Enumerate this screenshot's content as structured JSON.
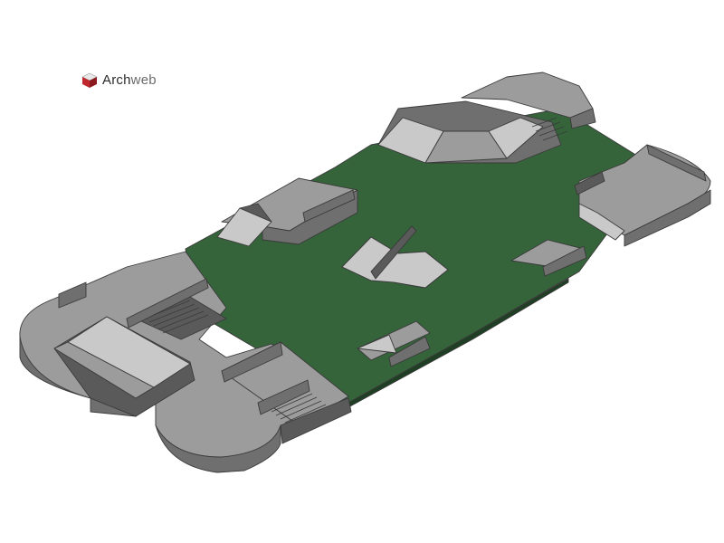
{
  "logo": {
    "icon": "cube-icon",
    "text_part1": "Arch",
    "text_part2": "web",
    "colors": {
      "cube_top": "#e8e8e8",
      "cube_left": "#c0282d",
      "cube_right": "#8a1a1e",
      "text_dark": "#2b2b2b",
      "text_light": "#6b6b6b"
    }
  },
  "scene": {
    "subject": "skatepark-3d-model",
    "colors": {
      "ground": "#35633a",
      "ground_edge": "#1f3f24",
      "concrete_top": "#9c9c9c",
      "concrete_side": "#6f6f6f",
      "concrete_dark": "#5a5a5a",
      "concrete_light": "#c9c9c9",
      "edge": "#3a3a3a"
    }
  }
}
